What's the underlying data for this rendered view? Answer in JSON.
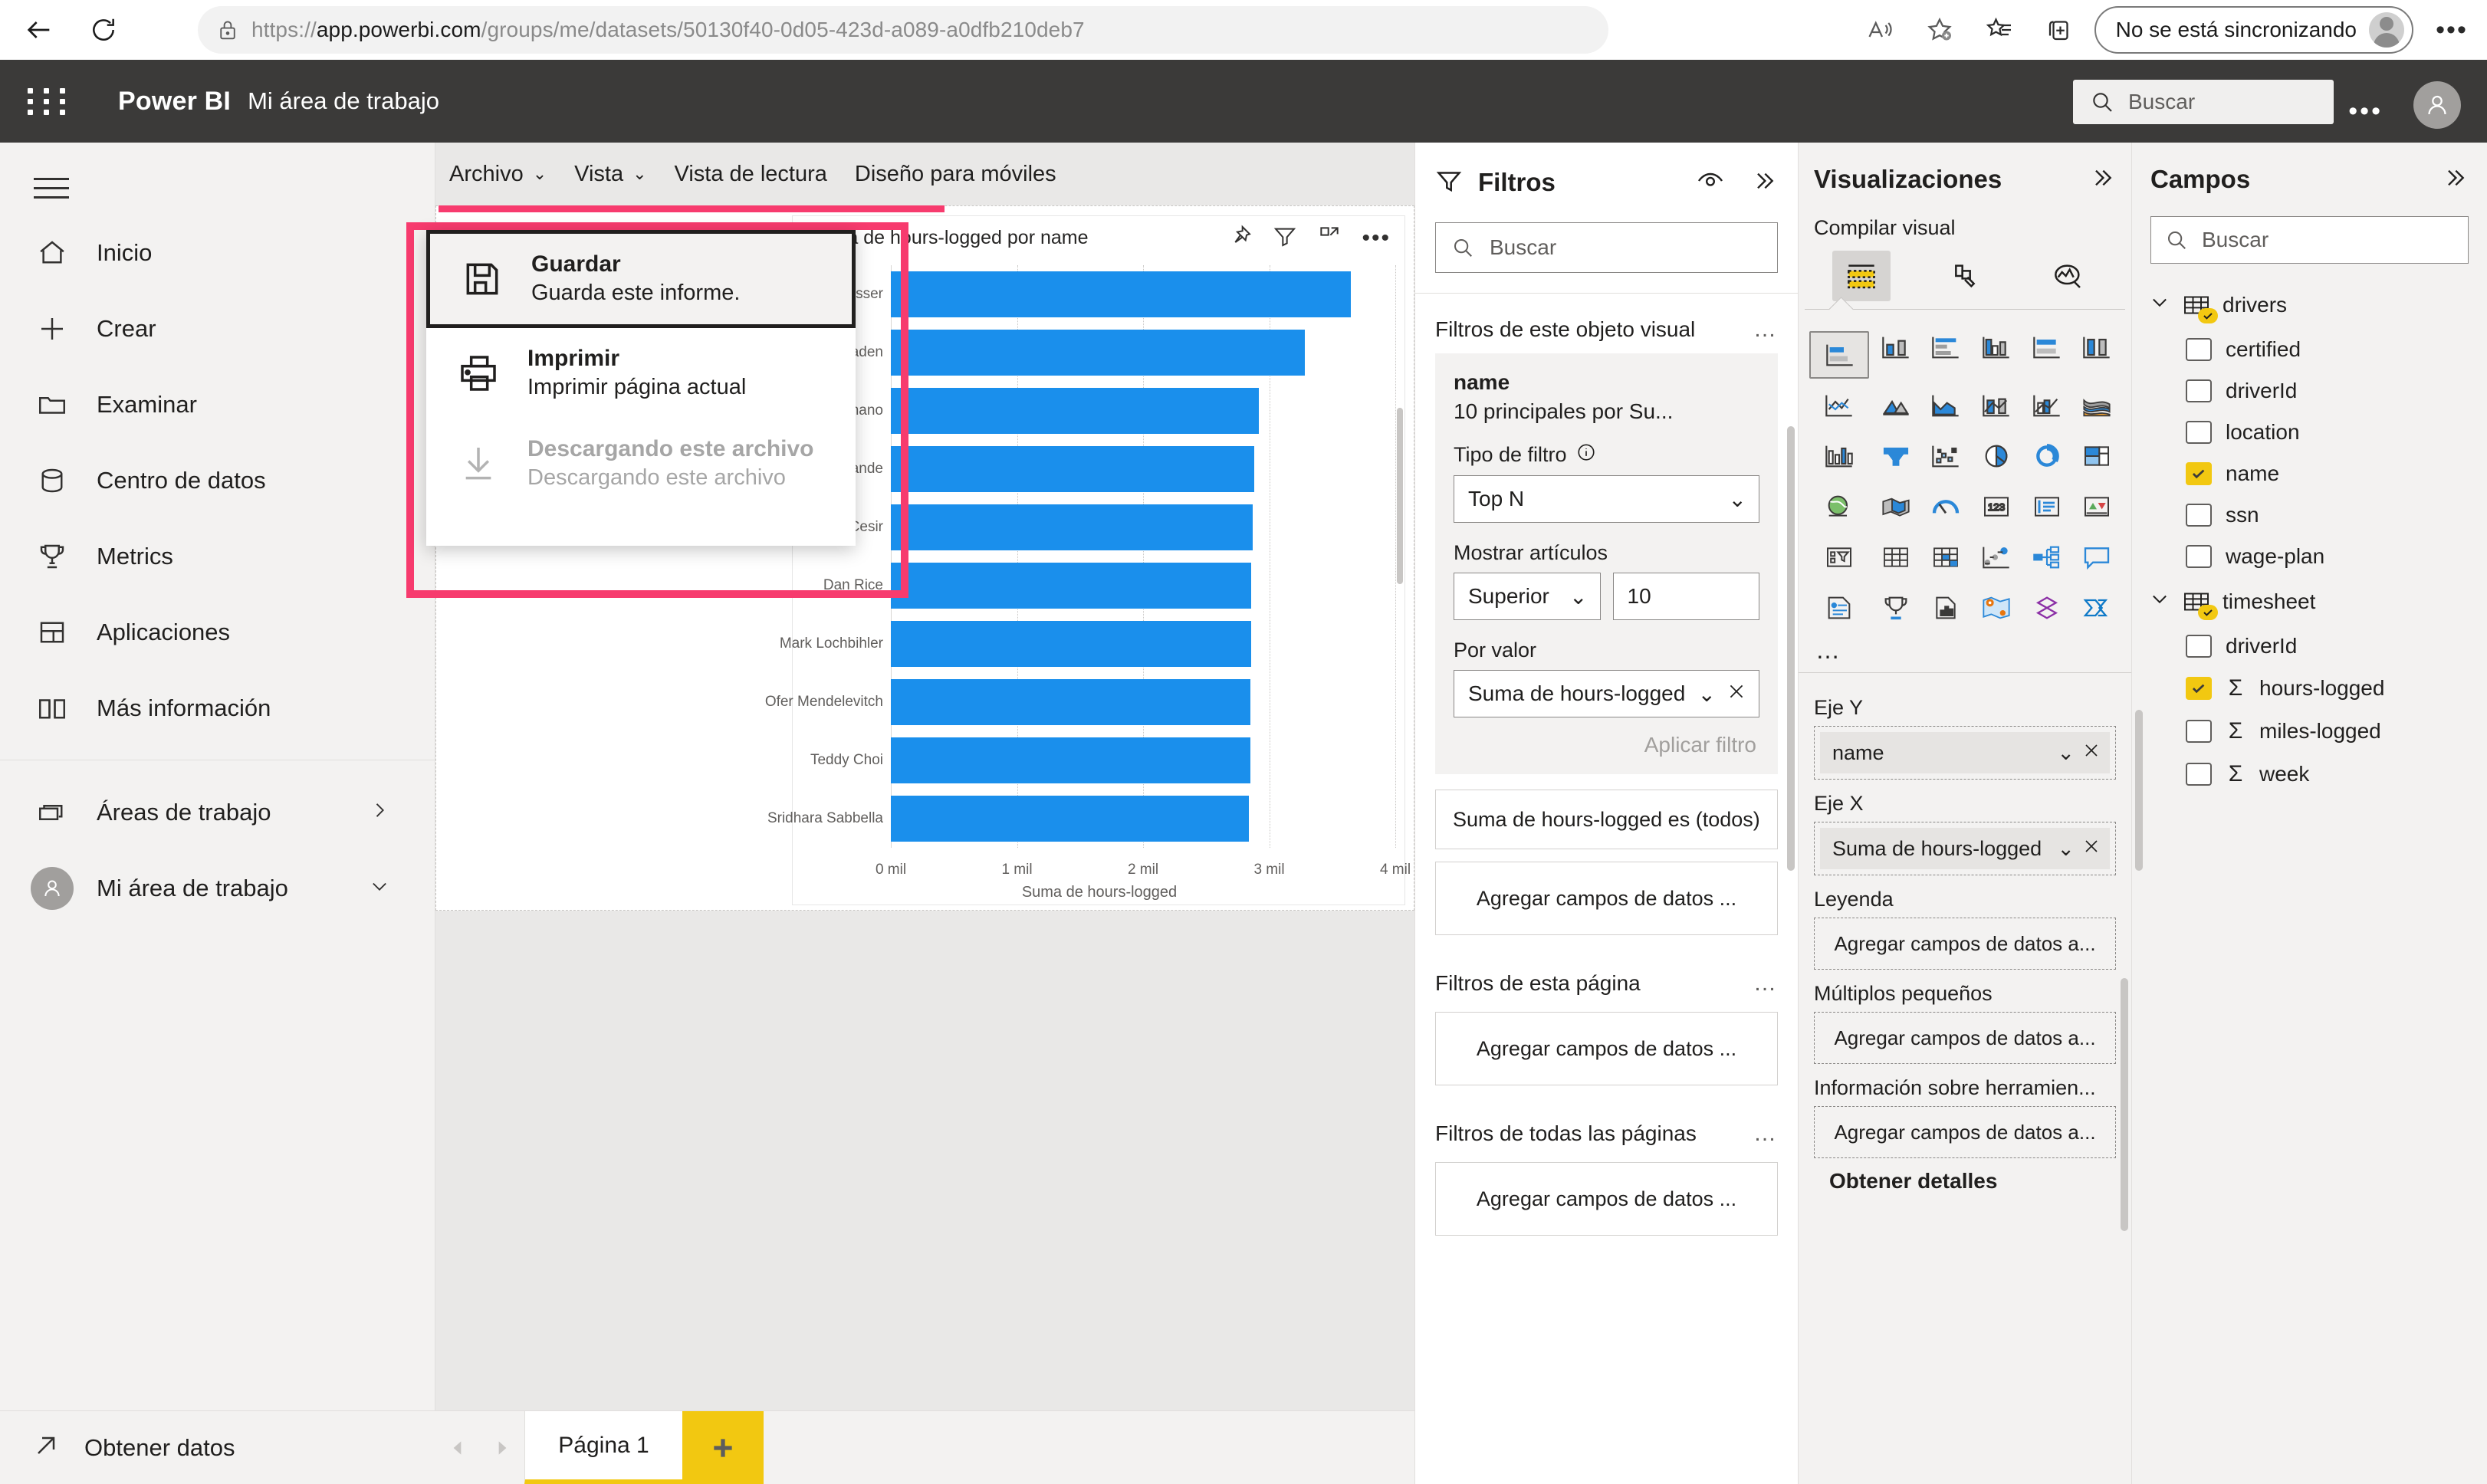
{
  "browser": {
    "url_prefix": "https://",
    "url_bold": "app.powerbi.com",
    "url_rest": "/groups/me/datasets/50130f40-0d05-423d-a089-a0dfb210deb7",
    "full_url": "https://app.powerbi.com/groups/me/datasets/50130f40-0d05-423d-a089-a0dfb210deb7",
    "sync_label": "No se está sincronizando",
    "icons": [
      "back-icon",
      "reload-icon",
      "lock-icon",
      "read-aloud-icon",
      "add-favorite-icon",
      "collections-icon",
      "split-screen-icon",
      "browser-more-icon"
    ]
  },
  "header": {
    "brand": "Power BI",
    "workspace": "Mi área de trabajo",
    "search_placeholder": "Buscar",
    "more_label": "…"
  },
  "sidebar": {
    "items": [
      {
        "label": "Inicio",
        "icon": "home-icon"
      },
      {
        "label": "Crear",
        "icon": "plus-icon"
      },
      {
        "label": "Examinar",
        "icon": "folder-icon"
      },
      {
        "label": "Centro de datos",
        "icon": "database-icon"
      },
      {
        "label": "Metrics",
        "icon": "trophy-icon"
      },
      {
        "label": "Aplicaciones",
        "icon": "apps-icon"
      },
      {
        "label": "Más información",
        "icon": "book-icon"
      }
    ],
    "groups": [
      {
        "label": "Áreas de trabajo",
        "icon": "workspaces-icon",
        "chevron": "right"
      },
      {
        "label": "Mi área de trabajo",
        "icon": "avatar-icon",
        "chevron": "down"
      }
    ],
    "footer": {
      "label": "Obtener datos",
      "icon": "get-data-icon"
    }
  },
  "report_toolbar": {
    "tabs": [
      {
        "label": "Archivo",
        "has_chevron": true,
        "active": true
      },
      {
        "label": "Vista",
        "has_chevron": true,
        "active": false
      },
      {
        "label": "Vista de lectura",
        "has_chevron": false,
        "active": false
      },
      {
        "label": "Diseño para móviles",
        "has_chevron": false,
        "active": false
      }
    ],
    "icons": [
      {
        "name": "comment-icon",
        "chevron": false
      },
      {
        "name": "smart-narrative-icon",
        "chevron": true
      },
      {
        "name": "text-box-icon",
        "chevron": false
      },
      {
        "name": "shapes-icon",
        "chevron": true
      },
      {
        "name": "buttons-icon",
        "chevron": true
      },
      {
        "name": "visual-interactions-icon",
        "chevron": true
      },
      {
        "name": "reset-icon",
        "chevron": false
      },
      {
        "name": "bookmarks-icon",
        "chevron": false
      },
      {
        "name": "save-icon",
        "chevron": false
      },
      {
        "name": "more-icon",
        "chevron": false
      }
    ]
  },
  "file_menu": {
    "items": [
      {
        "title": "Guardar",
        "subtitle": "Guarda este informe.",
        "icon": "floppy-save-icon",
        "state": "focused"
      },
      {
        "title": "Imprimir",
        "subtitle": "Imprimir página actual",
        "icon": "printer-icon",
        "state": "enabled"
      },
      {
        "title": "Descargando este archivo",
        "subtitle": "Descargando este archivo",
        "icon": "download-icon",
        "state": "disabled"
      }
    ],
    "highlight_color": "#f73b6e"
  },
  "visual": {
    "title": "Suma de hours-logged por name",
    "actions": [
      "pin-icon",
      "filter-icon",
      "focus-mode-icon",
      "more-options-icon"
    ]
  },
  "chart_data": {
    "type": "bar",
    "orientation": "horizontal",
    "title": "Suma de hours-logged por name",
    "xlabel": "Suma de hours-logged",
    "ylabel": "name",
    "xlim": [
      0,
      4000
    ],
    "xticks": [
      0,
      1000,
      2000,
      3000,
      4000
    ],
    "xticklabels": [
      "0 mil",
      "1 mil",
      "2 mil",
      "3 mil",
      "4 mil"
    ],
    "grid": true,
    "legend": false,
    "bar_color": "#1a8fec",
    "categories": [
      "Stephanie Engesser",
      "Joanne Vetticaden",
      "Frank Romano",
      "Andrew Grande",
      "Adis Cesir",
      "Dan Rice",
      "Mark Lochbihler",
      "Ofer Mendelevitch",
      "Teddy Choi",
      "Sridhara Sabbella"
    ],
    "values": [
      3650,
      3280,
      2920,
      2880,
      2870,
      2860,
      2860,
      2850,
      2850,
      2840
    ]
  },
  "page_tabs": {
    "prev_label": "◀",
    "next_label": "▶",
    "tabs": [
      {
        "label": "Página 1",
        "active": true
      }
    ],
    "add_label": "+"
  },
  "filters": {
    "title": "Filtros",
    "search_placeholder": "Buscar",
    "header_icons": [
      "filter-icon",
      "eye-icon",
      "expand-icon"
    ],
    "sections": [
      {
        "label": "Filtros de este objeto visual",
        "more": "…"
      },
      {
        "label": "Filtros de esta página",
        "more": "…"
      },
      {
        "label": "Filtros de todas las páginas",
        "more": "…"
      }
    ],
    "visual_filter": {
      "field": "name",
      "summary": "10 principales por Su...",
      "type_label": "Tipo de filtro",
      "type_value": "Top N",
      "items_label": "Mostrar artículos",
      "items_mode": "Superior",
      "items_count": "10",
      "by_value_label": "Por valor",
      "by_value": "Suma de hours-logged",
      "apply_label": "Aplicar filtro"
    },
    "second_card": "Suma de hours-logged es (todos)",
    "add_field_label": "Agregar campos de datos ..."
  },
  "visualizations": {
    "title": "Visualizaciones",
    "subtitle": "Compilar visual",
    "tabs": [
      {
        "name": "build-visual-tab",
        "active": true
      },
      {
        "name": "format-visual-tab",
        "active": false
      },
      {
        "name": "analytics-tab",
        "active": false
      }
    ],
    "gallery_more": "…",
    "wells": [
      {
        "label": "Eje Y",
        "chip": "name",
        "empty": false
      },
      {
        "label": "Eje X",
        "chip": "Suma de hours-logged",
        "empty": false
      },
      {
        "label": "Leyenda",
        "chip": "Agregar campos de datos a...",
        "empty": true
      },
      {
        "label": "Múltiplos pequeños",
        "chip": "Agregar campos de datos a...",
        "empty": true
      },
      {
        "label": "Información sobre herramien...",
        "chip": "Agregar campos de datos a...",
        "empty": true
      }
    ],
    "footer_label": "Obtener detalles"
  },
  "campos": {
    "title": "Campos",
    "search_placeholder": "Buscar",
    "tables": [
      {
        "name": "drivers",
        "expanded": true,
        "fields": [
          {
            "name": "certified",
            "checked": false,
            "measure": false
          },
          {
            "name": "driverId",
            "checked": false,
            "measure": false
          },
          {
            "name": "location",
            "checked": false,
            "measure": false
          },
          {
            "name": "name",
            "checked": true,
            "measure": false
          },
          {
            "name": "ssn",
            "checked": false,
            "measure": false
          },
          {
            "name": "wage-plan",
            "checked": false,
            "measure": false
          }
        ]
      },
      {
        "name": "timesheet",
        "expanded": true,
        "fields": [
          {
            "name": "driverId",
            "checked": false,
            "measure": false
          },
          {
            "name": "hours-logged",
            "checked": true,
            "measure": true
          },
          {
            "name": "miles-logged",
            "checked": false,
            "measure": true
          },
          {
            "name": "week",
            "checked": false,
            "measure": true
          }
        ]
      }
    ]
  },
  "colors": {
    "accent_yellow": "#f2c811",
    "bar_blue": "#1a8fec",
    "highlight_pink": "#f73b6e",
    "header_dark": "#3b3a39",
    "panel_gray": "#f3f2f1"
  }
}
